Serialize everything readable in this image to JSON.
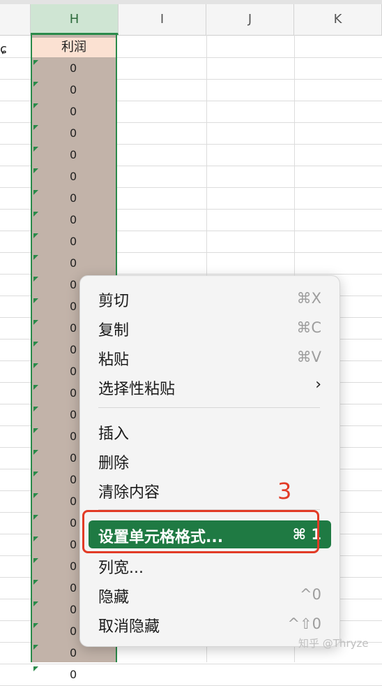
{
  "columns": [
    {
      "name": "col-h-header",
      "label": "H"
    },
    {
      "name": "col-i-header",
      "label": "I"
    },
    {
      "name": "col-j-header",
      "label": "J"
    },
    {
      "name": "col-k-header",
      "label": "K"
    }
  ],
  "partial_left_text": "ɕ",
  "header_cell": "利润",
  "cell_value": "0",
  "visible_zero_rows": 29,
  "menu": {
    "items": [
      {
        "label": "剪切",
        "shortcut": "⌘X"
      },
      {
        "label": "复制",
        "shortcut": "⌘C"
      },
      {
        "label": "粘贴",
        "shortcut": "⌘V"
      },
      {
        "label": "选择性粘贴",
        "shortcut": "›"
      },
      {
        "label": "插入",
        "shortcut": ""
      },
      {
        "label": "删除",
        "shortcut": ""
      },
      {
        "label": "清除内容",
        "shortcut": ""
      },
      {
        "label": "设置单元格格式...",
        "shortcut": "⌘ 1"
      },
      {
        "label": "列宽...",
        "shortcut": ""
      },
      {
        "label": "隐藏",
        "shortcut": "^0"
      },
      {
        "label": "取消隐藏",
        "shortcut": "^⇧0"
      }
    ]
  },
  "annotation": "3",
  "watermark": "知乎 @Thryze",
  "colors": {
    "selection_green": "#1f7a43",
    "highlight_red": "#e23b26",
    "selected_fill": "#c2b3a9"
  }
}
